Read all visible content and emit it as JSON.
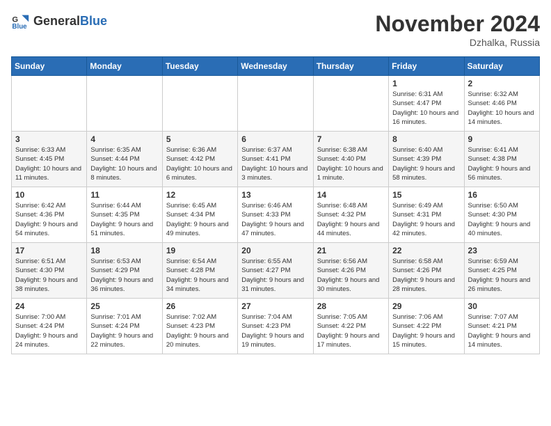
{
  "header": {
    "logo_general": "General",
    "logo_blue": "Blue",
    "title": "November 2024",
    "location": "Dzhalka, Russia"
  },
  "weekdays": [
    "Sunday",
    "Monday",
    "Tuesday",
    "Wednesday",
    "Thursday",
    "Friday",
    "Saturday"
  ],
  "weeks": [
    [
      {
        "day": "",
        "info": ""
      },
      {
        "day": "",
        "info": ""
      },
      {
        "day": "",
        "info": ""
      },
      {
        "day": "",
        "info": ""
      },
      {
        "day": "",
        "info": ""
      },
      {
        "day": "1",
        "info": "Sunrise: 6:31 AM\nSunset: 4:47 PM\nDaylight: 10 hours and 16 minutes."
      },
      {
        "day": "2",
        "info": "Sunrise: 6:32 AM\nSunset: 4:46 PM\nDaylight: 10 hours and 14 minutes."
      }
    ],
    [
      {
        "day": "3",
        "info": "Sunrise: 6:33 AM\nSunset: 4:45 PM\nDaylight: 10 hours and 11 minutes."
      },
      {
        "day": "4",
        "info": "Sunrise: 6:35 AM\nSunset: 4:44 PM\nDaylight: 10 hours and 8 minutes."
      },
      {
        "day": "5",
        "info": "Sunrise: 6:36 AM\nSunset: 4:42 PM\nDaylight: 10 hours and 6 minutes."
      },
      {
        "day": "6",
        "info": "Sunrise: 6:37 AM\nSunset: 4:41 PM\nDaylight: 10 hours and 3 minutes."
      },
      {
        "day": "7",
        "info": "Sunrise: 6:38 AM\nSunset: 4:40 PM\nDaylight: 10 hours and 1 minute."
      },
      {
        "day": "8",
        "info": "Sunrise: 6:40 AM\nSunset: 4:39 PM\nDaylight: 9 hours and 58 minutes."
      },
      {
        "day": "9",
        "info": "Sunrise: 6:41 AM\nSunset: 4:38 PM\nDaylight: 9 hours and 56 minutes."
      }
    ],
    [
      {
        "day": "10",
        "info": "Sunrise: 6:42 AM\nSunset: 4:36 PM\nDaylight: 9 hours and 54 minutes."
      },
      {
        "day": "11",
        "info": "Sunrise: 6:44 AM\nSunset: 4:35 PM\nDaylight: 9 hours and 51 minutes."
      },
      {
        "day": "12",
        "info": "Sunrise: 6:45 AM\nSunset: 4:34 PM\nDaylight: 9 hours and 49 minutes."
      },
      {
        "day": "13",
        "info": "Sunrise: 6:46 AM\nSunset: 4:33 PM\nDaylight: 9 hours and 47 minutes."
      },
      {
        "day": "14",
        "info": "Sunrise: 6:48 AM\nSunset: 4:32 PM\nDaylight: 9 hours and 44 minutes."
      },
      {
        "day": "15",
        "info": "Sunrise: 6:49 AM\nSunset: 4:31 PM\nDaylight: 9 hours and 42 minutes."
      },
      {
        "day": "16",
        "info": "Sunrise: 6:50 AM\nSunset: 4:30 PM\nDaylight: 9 hours and 40 minutes."
      }
    ],
    [
      {
        "day": "17",
        "info": "Sunrise: 6:51 AM\nSunset: 4:30 PM\nDaylight: 9 hours and 38 minutes."
      },
      {
        "day": "18",
        "info": "Sunrise: 6:53 AM\nSunset: 4:29 PM\nDaylight: 9 hours and 36 minutes."
      },
      {
        "day": "19",
        "info": "Sunrise: 6:54 AM\nSunset: 4:28 PM\nDaylight: 9 hours and 34 minutes."
      },
      {
        "day": "20",
        "info": "Sunrise: 6:55 AM\nSunset: 4:27 PM\nDaylight: 9 hours and 31 minutes."
      },
      {
        "day": "21",
        "info": "Sunrise: 6:56 AM\nSunset: 4:26 PM\nDaylight: 9 hours and 30 minutes."
      },
      {
        "day": "22",
        "info": "Sunrise: 6:58 AM\nSunset: 4:26 PM\nDaylight: 9 hours and 28 minutes."
      },
      {
        "day": "23",
        "info": "Sunrise: 6:59 AM\nSunset: 4:25 PM\nDaylight: 9 hours and 26 minutes."
      }
    ],
    [
      {
        "day": "24",
        "info": "Sunrise: 7:00 AM\nSunset: 4:24 PM\nDaylight: 9 hours and 24 minutes."
      },
      {
        "day": "25",
        "info": "Sunrise: 7:01 AM\nSunset: 4:24 PM\nDaylight: 9 hours and 22 minutes."
      },
      {
        "day": "26",
        "info": "Sunrise: 7:02 AM\nSunset: 4:23 PM\nDaylight: 9 hours and 20 minutes."
      },
      {
        "day": "27",
        "info": "Sunrise: 7:04 AM\nSunset: 4:23 PM\nDaylight: 9 hours and 19 minutes."
      },
      {
        "day": "28",
        "info": "Sunrise: 7:05 AM\nSunset: 4:22 PM\nDaylight: 9 hours and 17 minutes."
      },
      {
        "day": "29",
        "info": "Sunrise: 7:06 AM\nSunset: 4:22 PM\nDaylight: 9 hours and 15 minutes."
      },
      {
        "day": "30",
        "info": "Sunrise: 7:07 AM\nSunset: 4:21 PM\nDaylight: 9 hours and 14 minutes."
      }
    ]
  ]
}
